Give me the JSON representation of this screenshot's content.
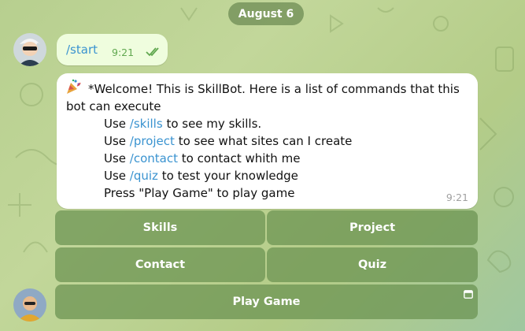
{
  "chat": {
    "date_label": "August 6",
    "outgoing": {
      "text": "/start",
      "time": "9:21"
    },
    "incoming": {
      "line1_prefix": "*Welcome! This is SkillBot. Here is a list of commands that this",
      "line2": "bot can execute",
      "cmds": [
        {
          "pre": "Use ",
          "cmd": "/skills",
          "post": " to see my skills."
        },
        {
          "pre": "Use ",
          "cmd": "/project",
          "post": " to see what sites can I create"
        },
        {
          "pre": "Use ",
          "cmd": "/contact",
          "post": " to contact whith me"
        },
        {
          "pre": "Use ",
          "cmd": "/quiz",
          "post": " to test your knowledge"
        }
      ],
      "last_line": "Press \"Play Game\" to play game",
      "time": "9:21"
    },
    "keyboard": {
      "skills": "Skills",
      "project": "Project",
      "contact": "Contact",
      "quiz": "Quiz",
      "play_game": "Play Game"
    }
  },
  "icons": {
    "party": "party-popper-icon",
    "read_status": "double-check-icon",
    "web_app": "window-icon"
  },
  "colors": {
    "link": "#3a93d0",
    "outgoing_bubble": "#effdde",
    "keyboard_button": "#6b9150"
  }
}
